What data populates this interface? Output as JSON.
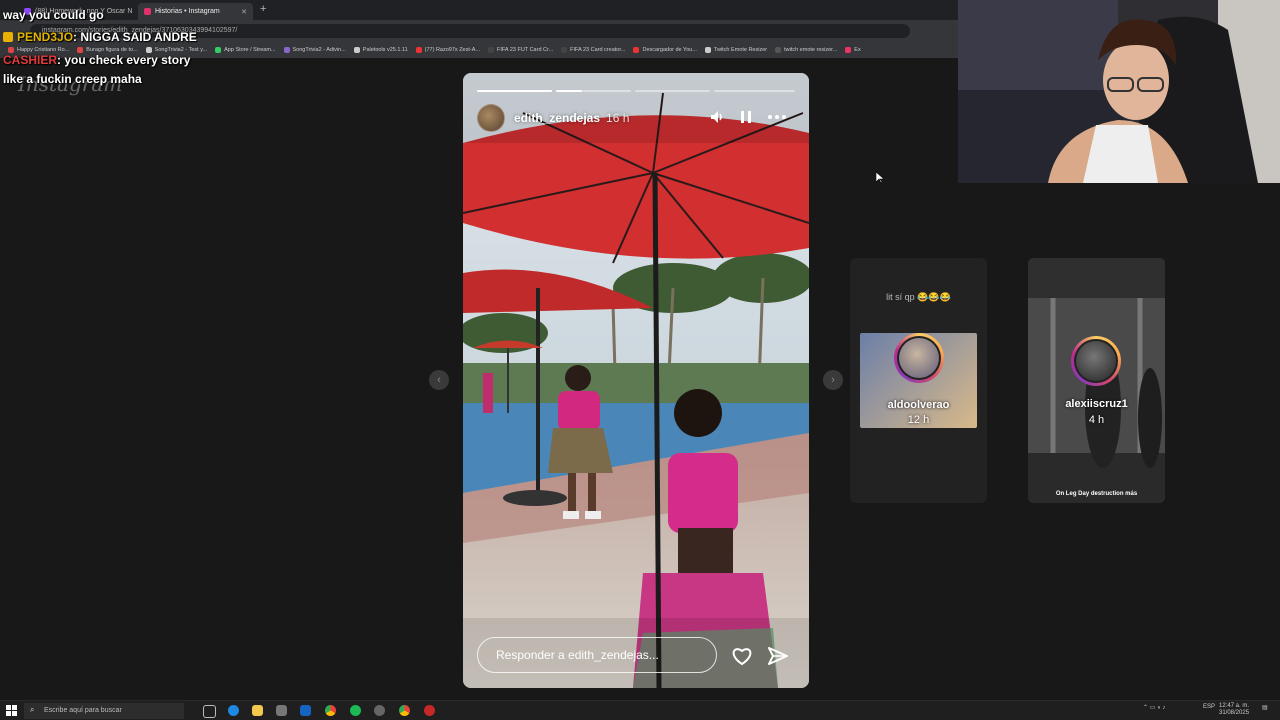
{
  "browser": {
    "tabs": [
      {
        "label": "(88) Homework_nog Y Oscar N"
      },
      {
        "label": "Historias • Instagram"
      }
    ],
    "url": "instagram.com/stories/edith_zendejas/3710630343994102597/",
    "bookmarks": [
      "Happy Cristiano Ro...",
      "Burago figura de to...",
      "SongTrivia2 - Test y...",
      "App Store / Stream...",
      "SongTrivia2 - Adivin...",
      "Paletools v25.1.11",
      "(77) Razo97s Zest-A...",
      "FIFA 23 FUT Card Cr...",
      "FIFA 23 Card creator...",
      "Descargador de You...",
      "Twitch Emote Resizer",
      "twitch emote resizer...",
      "Ex"
    ]
  },
  "chat": [
    {
      "user": "",
      "text": "way you could go"
    },
    {
      "user": "PEND3JO",
      "text": ": NIGGA SAID ANDRE",
      "color": "#e0b400"
    },
    {
      "user": "CASHIER",
      "text": ": you check every story",
      "color": "#e23a3a"
    },
    {
      "user": "",
      "text": "like a fuckin creep maha"
    }
  ],
  "watermark": "Instagram",
  "story": {
    "username": "edith_zendejas",
    "time": "16 h",
    "reply_placeholder": "Responder a edith_zendejas...",
    "segments": 4,
    "active_segment": 1,
    "active_progress": 0.6
  },
  "side_stories": [
    {
      "username": "aldoolverao",
      "time": "12 h",
      "caption": "lit sí qp 😂😂😂"
    },
    {
      "username": "alexiiscruz1",
      "time": "4 h",
      "caption": "On Leg Day destruction más"
    }
  ],
  "taskbar": {
    "search_placeholder": "Escribe aquí para buscar",
    "time": "12:47 a. m.",
    "date": "31/08/2025",
    "lang": "ESP"
  },
  "colors": {
    "accent": "#ffffff",
    "bg": "#181818"
  }
}
